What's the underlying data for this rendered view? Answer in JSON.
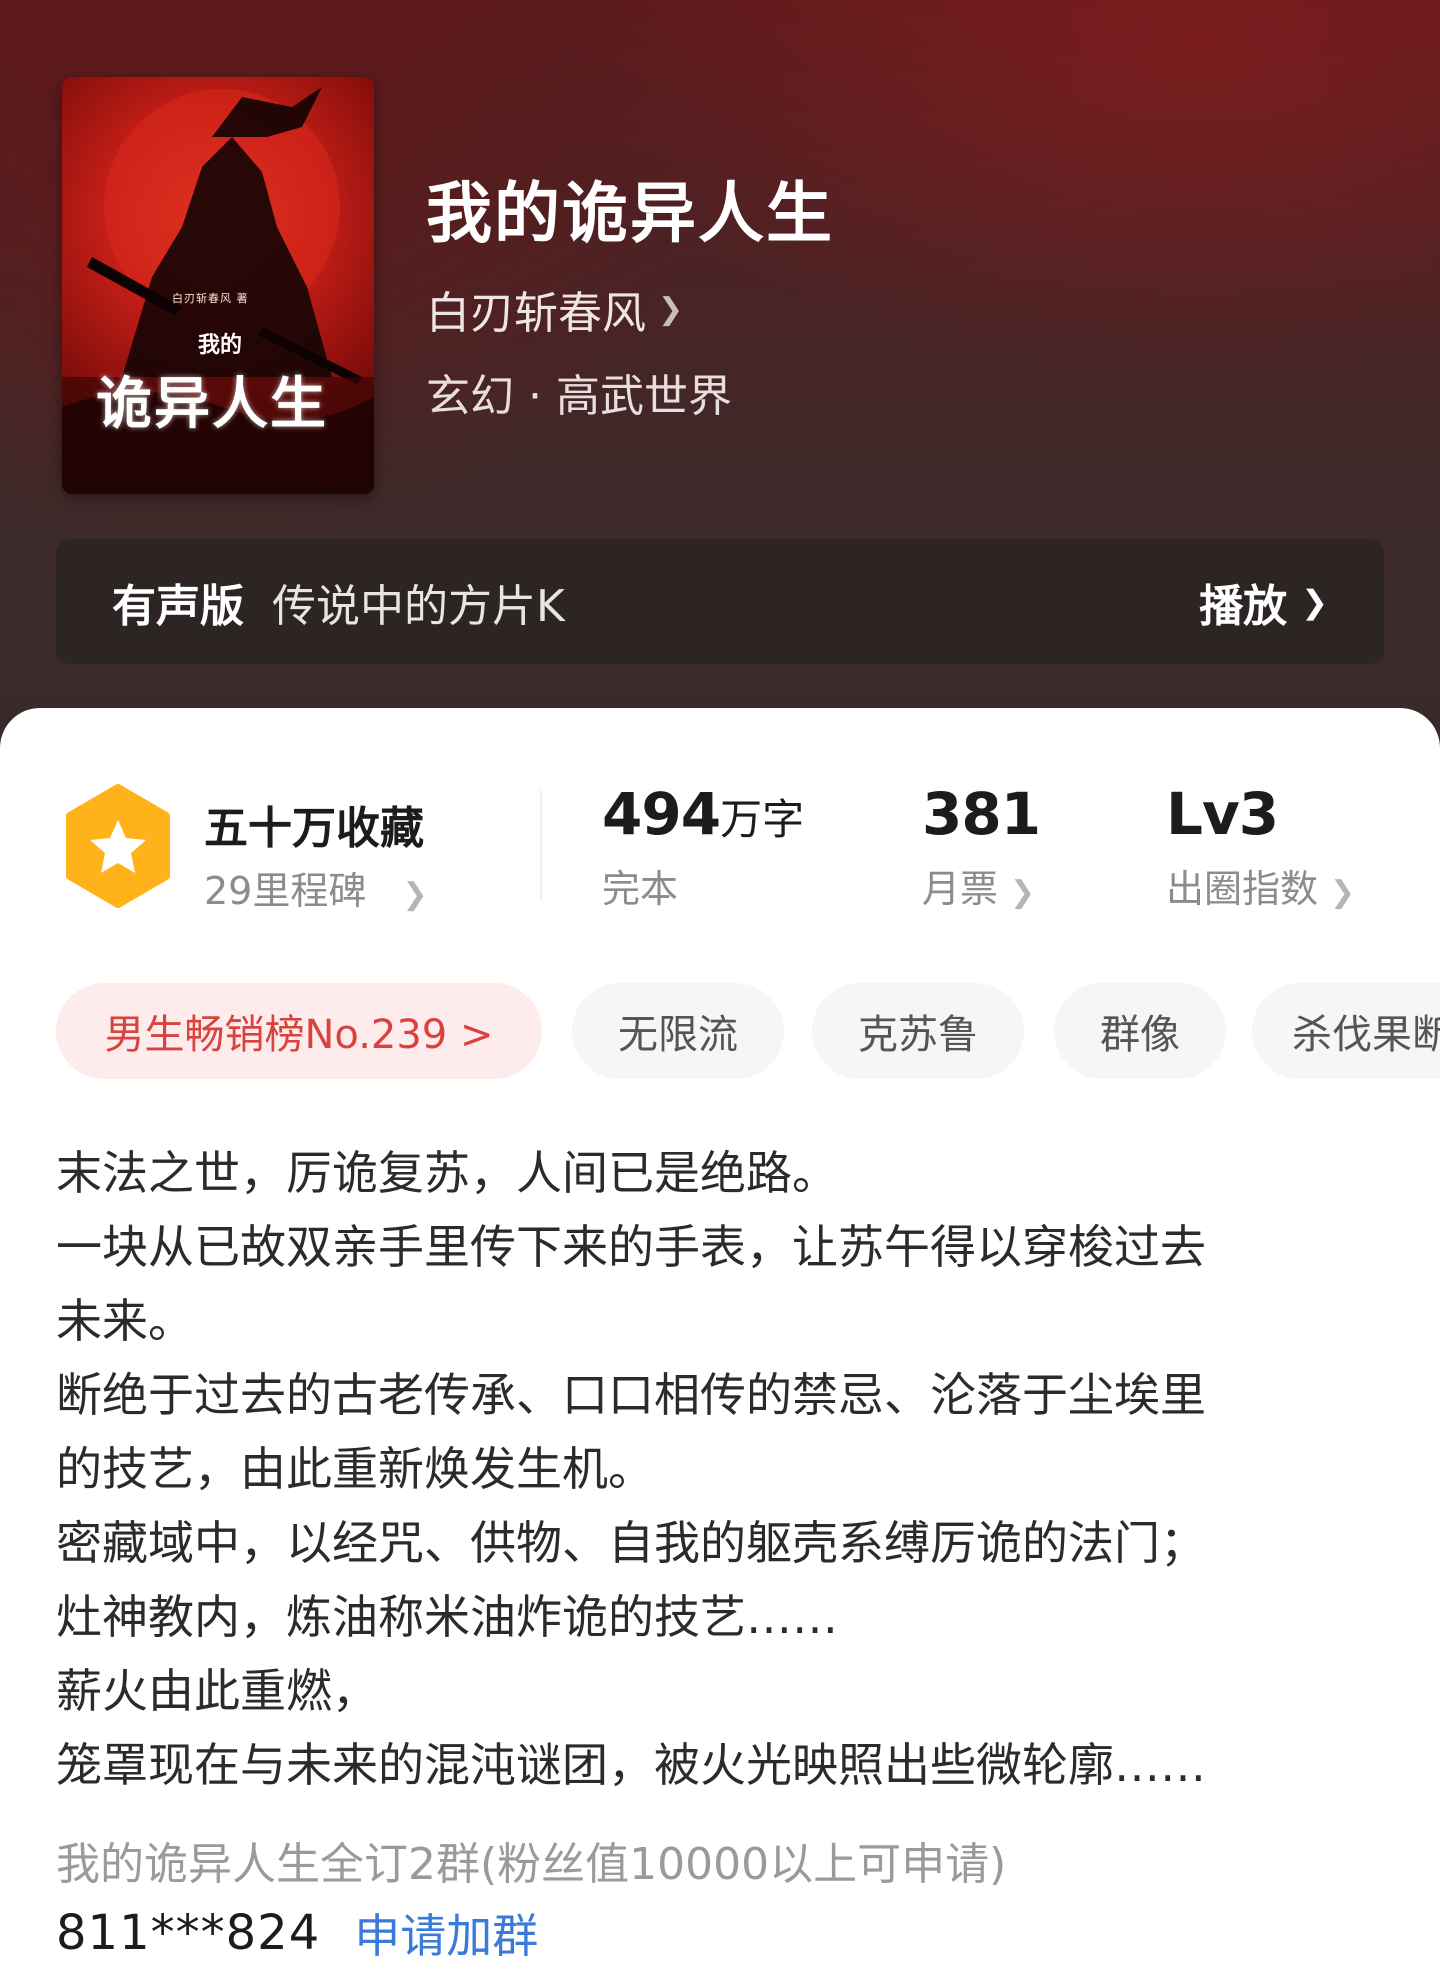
{
  "book": {
    "cover": {
      "author": "白刃斩春风 著",
      "small": "我的",
      "big": "诡异人生"
    },
    "title": "我的诡异人生",
    "author": "白刃斩春风",
    "genre": "玄幻 · 高武世界"
  },
  "audio": {
    "tag": "有声版",
    "narrator": "传说中的方片K",
    "play_label": "播放"
  },
  "stats": {
    "favorites": "五十万收藏",
    "milestones": "29里程碑",
    "word_count": "494",
    "word_unit": "万字",
    "status": "完本",
    "monthly_votes": "381",
    "monthly_votes_label": "月票",
    "level": "Lv3",
    "level_label": "出圈指数"
  },
  "tags": {
    "rank": "男生畅销榜No.239 >",
    "items": [
      "无限流",
      "克苏鲁",
      "群像",
      "杀伐果断"
    ]
  },
  "synopsis": [
    "末法之世，厉诡复苏，人间已是绝路。",
    "一块从已故双亲手里传下来的手表，让苏午得以穿梭过去",
    "未来。",
    "断绝于过去的古老传承、口口相传的禁忌、沦落于尘埃里",
    "的技艺，由此重新焕发生机。",
    "密藏域中，以经咒、供物、自我的躯壳系缚厉诡的法门；",
    "灶神教内，炼油称米油炸诡的技艺……",
    "薪火由此重燃，",
    "笼罩现在与未来的混沌谜团，被火光映照出些微轮廓……"
  ],
  "group": {
    "name": "我的诡异人生全订2群(粉丝值10000以上可申请)",
    "id": "811***824",
    "apply_label": "申请加群"
  },
  "colors": {
    "accent_red": "#d9423e",
    "link_blue": "#3a7ad9",
    "badge_orange": "#ffb21a"
  }
}
